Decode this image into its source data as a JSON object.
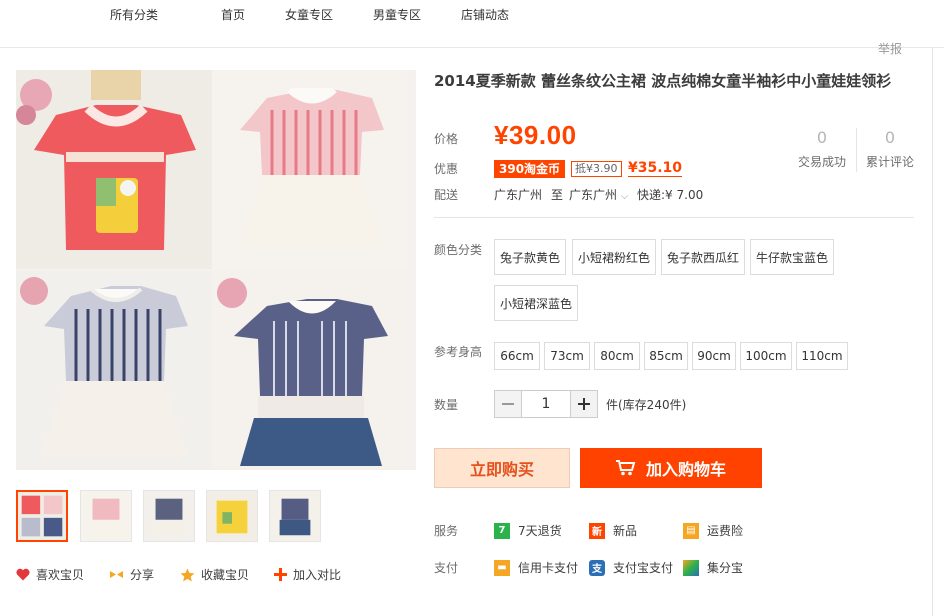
{
  "nav": {
    "items": [
      "所有分类",
      "首页",
      "女童专区",
      "男童专区",
      "店铺动态"
    ],
    "report": "举报"
  },
  "product": {
    "title": "2014夏季新款 蕾丝条纹公主裙 波点纯棉女童半袖衫中小童娃娃领衫",
    "price_label": "价格",
    "price": "¥39.00",
    "promo_label": "优惠",
    "promo_tag": "390淘金币",
    "promo_sub": "抵¥3.90",
    "promo_price": "¥35.10",
    "ship_label": "配送",
    "ship_from": "广东广州",
    "ship_to_word": "至",
    "ship_to": "广东广州",
    "ship_fee": "快递:¥ 7.00",
    "stats": [
      {
        "num": "0",
        "label": "交易成功"
      },
      {
        "num": "0",
        "label": "累计评论"
      }
    ]
  },
  "options": {
    "color_label": "颜色分类",
    "colors": [
      "兔子款黄色",
      "小短裙粉红色",
      "兔子款西瓜红",
      "牛仔款宝蓝色",
      "小短裙深蓝色"
    ],
    "size_label": "参考身高",
    "sizes": [
      "66cm",
      "73cm",
      "80cm",
      "85cm",
      "90cm",
      "100cm",
      "110cm"
    ],
    "qty_label": "数量",
    "qty": "1",
    "stock": "件(库存240件)"
  },
  "buttons": {
    "buy_now": "立即购买",
    "add_cart": "加入购物车"
  },
  "service": {
    "label": "服务",
    "items": [
      "7天退货",
      "新品",
      "运费险"
    ],
    "pay_label": "支付",
    "pay_items": [
      "信用卡支付",
      "支付宝支付",
      "集分宝"
    ]
  },
  "actions": [
    "喜欢宝贝",
    "分享",
    "收藏宝贝",
    "加入对比"
  ],
  "colors": {
    "accent": "#ff4400",
    "buy_now_bg": "#ffe4d0",
    "add_cart_bg": "#ff4200"
  }
}
